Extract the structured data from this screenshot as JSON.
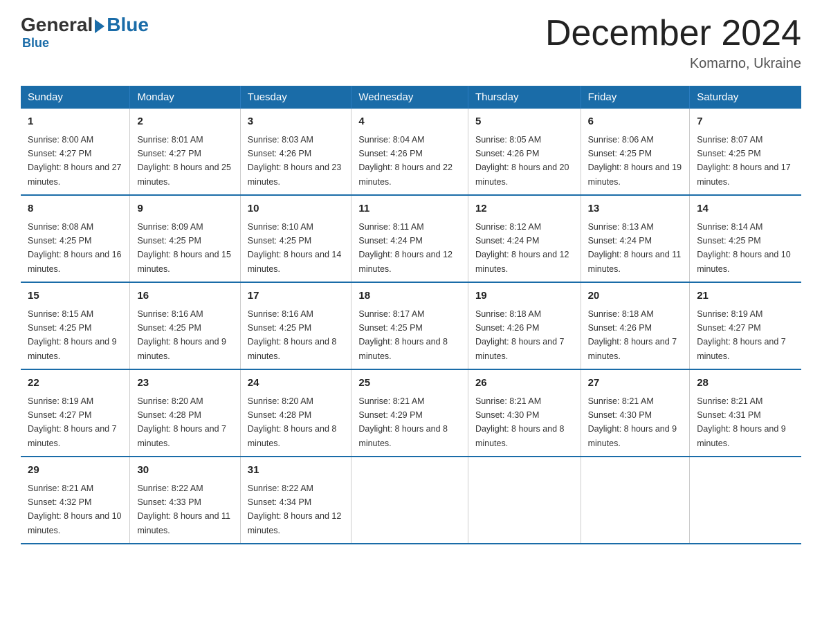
{
  "logo": {
    "general": "General",
    "blue": "Blue"
  },
  "title": "December 2024",
  "location": "Komarno, Ukraine",
  "days_of_week": [
    "Sunday",
    "Monday",
    "Tuesday",
    "Wednesday",
    "Thursday",
    "Friday",
    "Saturday"
  ],
  "weeks": [
    [
      {
        "day": "1",
        "sunrise": "8:00 AM",
        "sunset": "4:27 PM",
        "daylight": "8 hours and 27 minutes."
      },
      {
        "day": "2",
        "sunrise": "8:01 AM",
        "sunset": "4:27 PM",
        "daylight": "8 hours and 25 minutes."
      },
      {
        "day": "3",
        "sunrise": "8:03 AM",
        "sunset": "4:26 PM",
        "daylight": "8 hours and 23 minutes."
      },
      {
        "day": "4",
        "sunrise": "8:04 AM",
        "sunset": "4:26 PM",
        "daylight": "8 hours and 22 minutes."
      },
      {
        "day": "5",
        "sunrise": "8:05 AM",
        "sunset": "4:26 PM",
        "daylight": "8 hours and 20 minutes."
      },
      {
        "day": "6",
        "sunrise": "8:06 AM",
        "sunset": "4:25 PM",
        "daylight": "8 hours and 19 minutes."
      },
      {
        "day": "7",
        "sunrise": "8:07 AM",
        "sunset": "4:25 PM",
        "daylight": "8 hours and 17 minutes."
      }
    ],
    [
      {
        "day": "8",
        "sunrise": "8:08 AM",
        "sunset": "4:25 PM",
        "daylight": "8 hours and 16 minutes."
      },
      {
        "day": "9",
        "sunrise": "8:09 AM",
        "sunset": "4:25 PM",
        "daylight": "8 hours and 15 minutes."
      },
      {
        "day": "10",
        "sunrise": "8:10 AM",
        "sunset": "4:25 PM",
        "daylight": "8 hours and 14 minutes."
      },
      {
        "day": "11",
        "sunrise": "8:11 AM",
        "sunset": "4:24 PM",
        "daylight": "8 hours and 12 minutes."
      },
      {
        "day": "12",
        "sunrise": "8:12 AM",
        "sunset": "4:24 PM",
        "daylight": "8 hours and 12 minutes."
      },
      {
        "day": "13",
        "sunrise": "8:13 AM",
        "sunset": "4:24 PM",
        "daylight": "8 hours and 11 minutes."
      },
      {
        "day": "14",
        "sunrise": "8:14 AM",
        "sunset": "4:25 PM",
        "daylight": "8 hours and 10 minutes."
      }
    ],
    [
      {
        "day": "15",
        "sunrise": "8:15 AM",
        "sunset": "4:25 PM",
        "daylight": "8 hours and 9 minutes."
      },
      {
        "day": "16",
        "sunrise": "8:16 AM",
        "sunset": "4:25 PM",
        "daylight": "8 hours and 9 minutes."
      },
      {
        "day": "17",
        "sunrise": "8:16 AM",
        "sunset": "4:25 PM",
        "daylight": "8 hours and 8 minutes."
      },
      {
        "day": "18",
        "sunrise": "8:17 AM",
        "sunset": "4:25 PM",
        "daylight": "8 hours and 8 minutes."
      },
      {
        "day": "19",
        "sunrise": "8:18 AM",
        "sunset": "4:26 PM",
        "daylight": "8 hours and 7 minutes."
      },
      {
        "day": "20",
        "sunrise": "8:18 AM",
        "sunset": "4:26 PM",
        "daylight": "8 hours and 7 minutes."
      },
      {
        "day": "21",
        "sunrise": "8:19 AM",
        "sunset": "4:27 PM",
        "daylight": "8 hours and 7 minutes."
      }
    ],
    [
      {
        "day": "22",
        "sunrise": "8:19 AM",
        "sunset": "4:27 PM",
        "daylight": "8 hours and 7 minutes."
      },
      {
        "day": "23",
        "sunrise": "8:20 AM",
        "sunset": "4:28 PM",
        "daylight": "8 hours and 7 minutes."
      },
      {
        "day": "24",
        "sunrise": "8:20 AM",
        "sunset": "4:28 PM",
        "daylight": "8 hours and 8 minutes."
      },
      {
        "day": "25",
        "sunrise": "8:21 AM",
        "sunset": "4:29 PM",
        "daylight": "8 hours and 8 minutes."
      },
      {
        "day": "26",
        "sunrise": "8:21 AM",
        "sunset": "4:30 PM",
        "daylight": "8 hours and 8 minutes."
      },
      {
        "day": "27",
        "sunrise": "8:21 AM",
        "sunset": "4:30 PM",
        "daylight": "8 hours and 9 minutes."
      },
      {
        "day": "28",
        "sunrise": "8:21 AM",
        "sunset": "4:31 PM",
        "daylight": "8 hours and 9 minutes."
      }
    ],
    [
      {
        "day": "29",
        "sunrise": "8:21 AM",
        "sunset": "4:32 PM",
        "daylight": "8 hours and 10 minutes."
      },
      {
        "day": "30",
        "sunrise": "8:22 AM",
        "sunset": "4:33 PM",
        "daylight": "8 hours and 11 minutes."
      },
      {
        "day": "31",
        "sunrise": "8:22 AM",
        "sunset": "4:34 PM",
        "daylight": "8 hours and 12 minutes."
      },
      null,
      null,
      null,
      null
    ]
  ]
}
